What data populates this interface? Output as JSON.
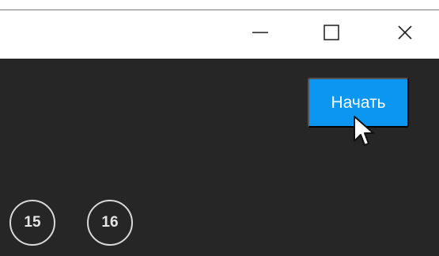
{
  "titlebar": {
    "controls": [
      {
        "name": "minimize",
        "icon": "minimize-icon"
      },
      {
        "name": "maximize",
        "icon": "maximize-icon"
      },
      {
        "name": "close",
        "icon": "close-icon"
      }
    ]
  },
  "main": {
    "start_button": {
      "label": "Начать",
      "color": "#0b97f1"
    },
    "badges": [
      "15",
      "16"
    ]
  },
  "colors": {
    "window_bg": "#ffffff",
    "content_bg": "#262626",
    "badge_border": "#d9d9d9",
    "titlebar_icon": "#1f1f1f"
  }
}
